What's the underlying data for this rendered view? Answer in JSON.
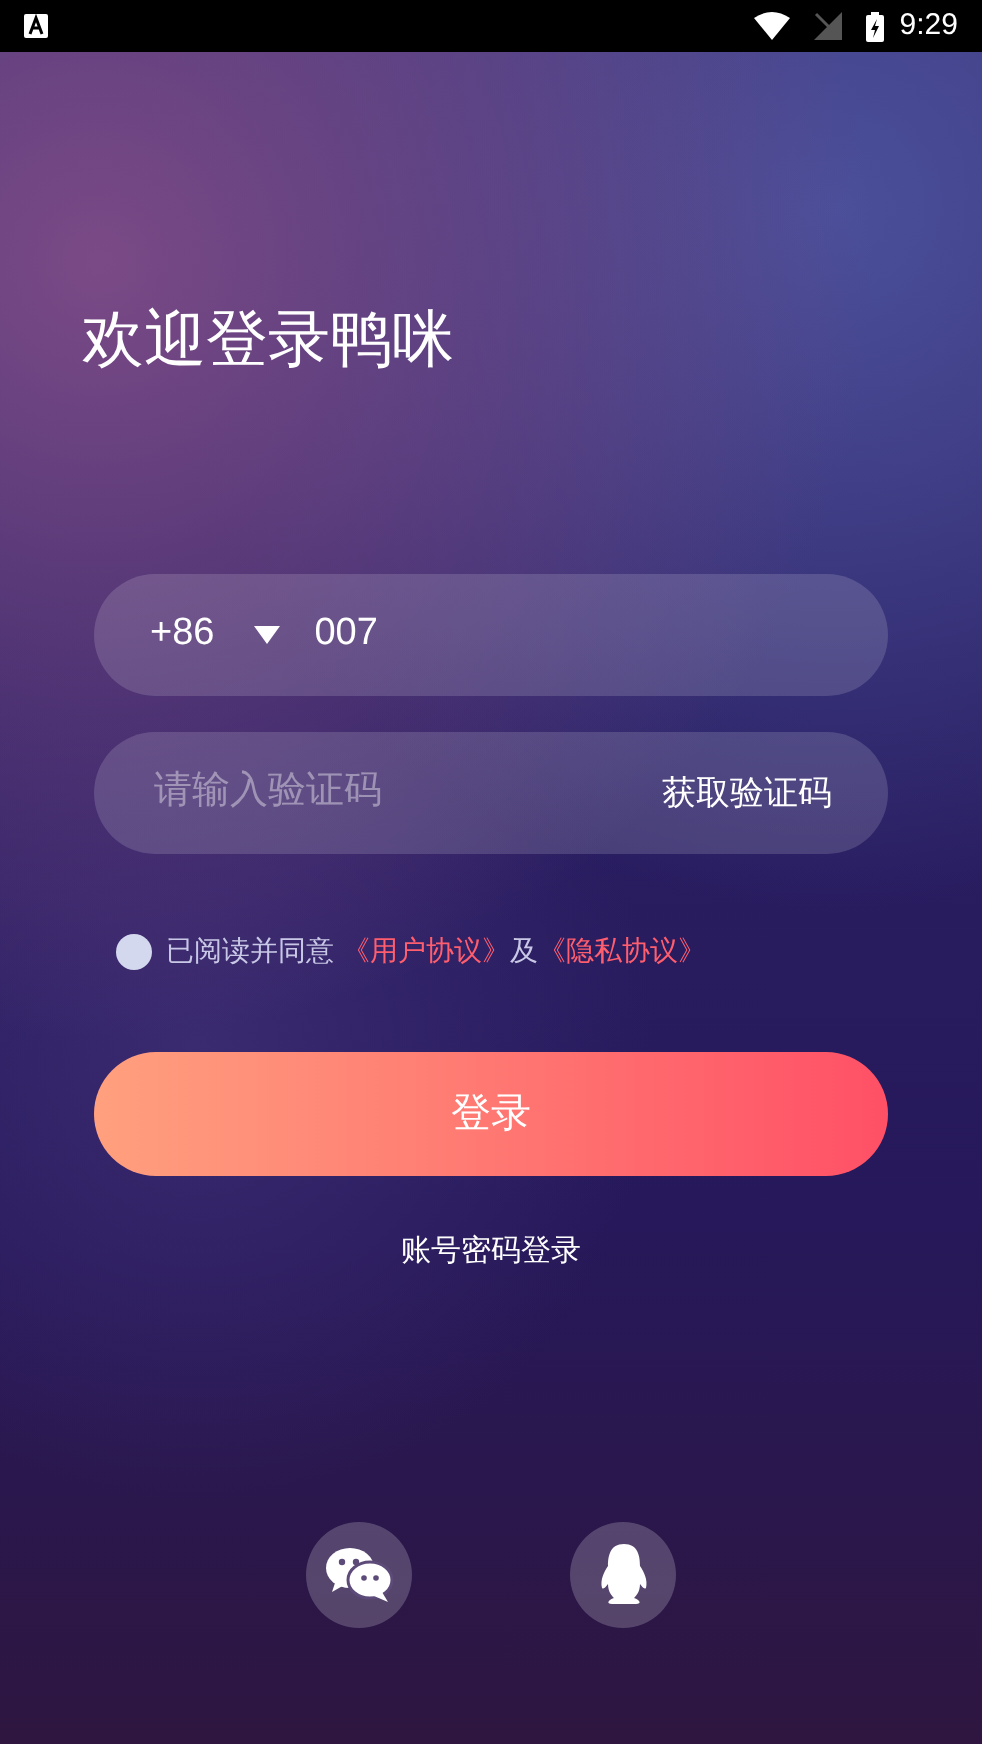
{
  "status_bar": {
    "time": "9:29"
  },
  "title": "欢迎登录鸭咪",
  "phone": {
    "country_code": "+86",
    "value": "007"
  },
  "code": {
    "placeholder": "请输入验证码",
    "button": "获取验证码"
  },
  "agreement": {
    "checked": false,
    "prefix": "已阅读并同意",
    "link_1": "《用户协议》",
    "joiner": "及",
    "link_2": "《隐私协议》"
  },
  "login_button": "登录",
  "password_login": "账号密码登录",
  "social": [
    {
      "kind": "wechat"
    },
    {
      "kind": "qq"
    }
  ]
}
